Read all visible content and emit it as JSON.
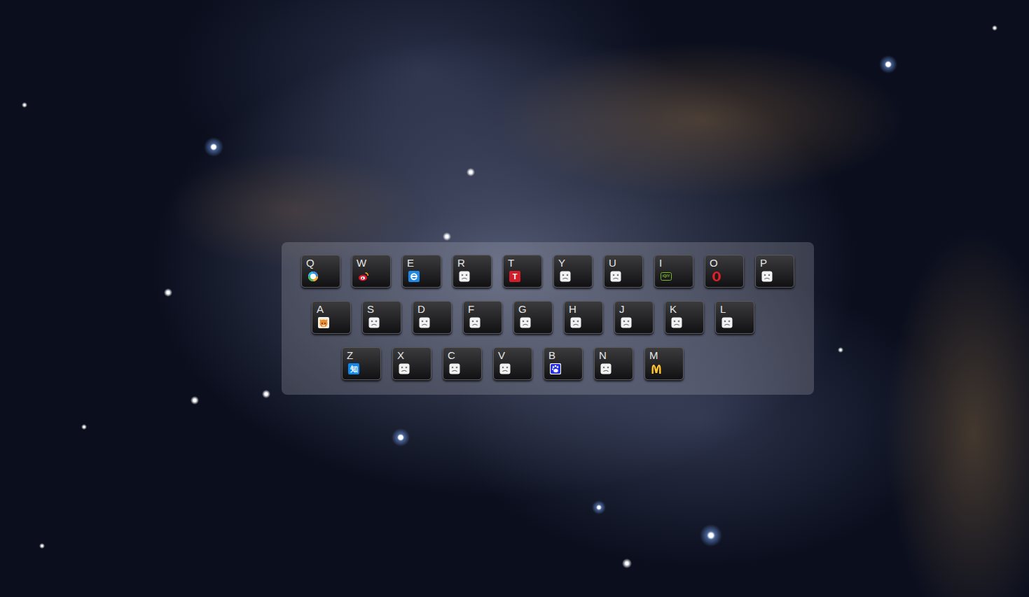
{
  "keyboard": {
    "rows": [
      [
        {
          "key": "Q",
          "kind": "qqbrowser"
        },
        {
          "key": "W",
          "kind": "weibo"
        },
        {
          "key": "E",
          "kind": "ie"
        },
        {
          "key": "R",
          "kind": "placeholder"
        },
        {
          "key": "T",
          "kind": "tmall",
          "icon_text": "T"
        },
        {
          "key": "Y",
          "kind": "placeholder"
        },
        {
          "key": "U",
          "kind": "placeholder"
        },
        {
          "key": "I",
          "kind": "iqiyi",
          "icon_text": "iQIY"
        },
        {
          "key": "O",
          "kind": "opera"
        },
        {
          "key": "P",
          "kind": "placeholder"
        }
      ],
      [
        {
          "key": "A",
          "kind": "firefox"
        },
        {
          "key": "S",
          "kind": "placeholder"
        },
        {
          "key": "D",
          "kind": "placeholder"
        },
        {
          "key": "F",
          "kind": "placeholder"
        },
        {
          "key": "G",
          "kind": "placeholder"
        },
        {
          "key": "H",
          "kind": "placeholder"
        },
        {
          "key": "J",
          "kind": "placeholder"
        },
        {
          "key": "K",
          "kind": "placeholder"
        },
        {
          "key": "L",
          "kind": "placeholder"
        }
      ],
      [
        {
          "key": "Z",
          "kind": "zhihu",
          "icon_text": "知"
        },
        {
          "key": "X",
          "kind": "placeholder"
        },
        {
          "key": "C",
          "kind": "placeholder"
        },
        {
          "key": "V",
          "kind": "placeholder"
        },
        {
          "key": "B",
          "kind": "baidu"
        },
        {
          "key": "N",
          "kind": "placeholder"
        },
        {
          "key": "M",
          "kind": "mcdonalds"
        }
      ]
    ]
  }
}
